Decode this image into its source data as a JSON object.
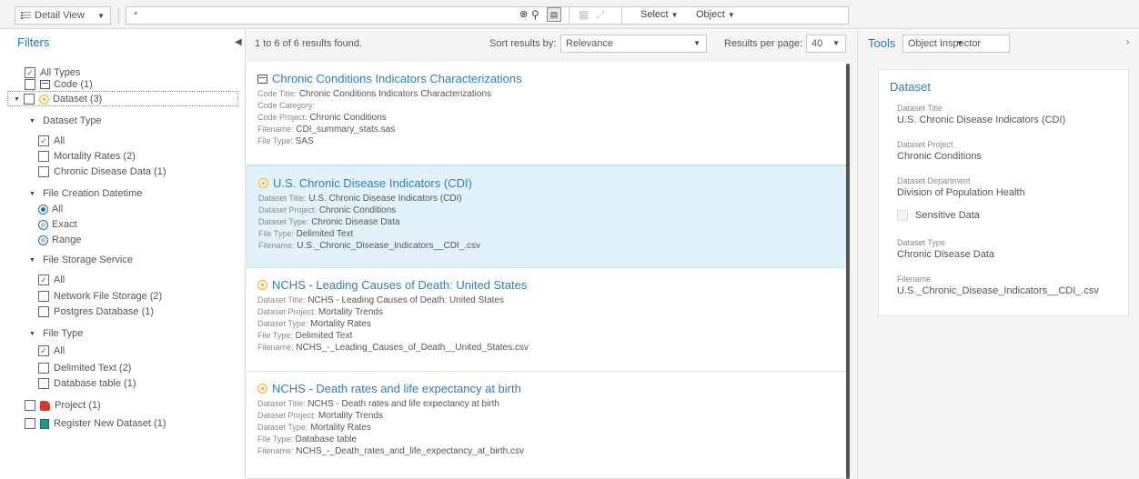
{
  "toolbar": {
    "view_label": "Detail View",
    "search_value": "*",
    "select_label": "Select",
    "object_label": "Object"
  },
  "filters": {
    "title": "Filters",
    "all_types": "All Types",
    "code": "Code (1)",
    "dataset": "Dataset (3)",
    "dataset_type": {
      "title": "Dataset Type",
      "options": [
        "All",
        "Mortality Rates (2)",
        "Chronic Disease Data (1)"
      ]
    },
    "file_creation": {
      "title": "File Creation Datetime",
      "options": [
        "All",
        "Exact",
        "Range"
      ]
    },
    "file_storage": {
      "title": "File Storage Service",
      "options": [
        "All",
        "Network File Storage (2)",
        "Postgres Database (1)"
      ]
    },
    "file_type": {
      "title": "File Type",
      "options": [
        "All",
        "Delimited Text (2)",
        "Database table (1)"
      ]
    },
    "project": "Project (1)",
    "register": "Register New Dataset (1)"
  },
  "results": {
    "count": "1 to 6 of 6 results found.",
    "sort_label": "Sort results by:",
    "sort_value": "Relevance",
    "per_page_label": "Results per page:",
    "per_page_value": "40",
    "cards": [
      {
        "title": "Chronic Conditions Indicators Characterizations",
        "lines": [
          {
            "k": "Code Title:",
            "v": "Chronic Conditions Indicators Characterizations"
          },
          {
            "k": "Code Category:",
            "v": ""
          },
          {
            "k": "Code Project:",
            "v": "Chronic Conditions"
          },
          {
            "k": "Filename:",
            "v": "CDI_summary_stats.sas"
          },
          {
            "k": "File Type:",
            "v": "SAS"
          }
        ]
      },
      {
        "title": "U.S. Chronic Disease Indicators (CDI)",
        "lines": [
          {
            "k": "Dataset Title:",
            "v": "U.S. Chronic Disease Indicators (CDI)"
          },
          {
            "k": "Dataset Project:",
            "v": "Chronic Conditions"
          },
          {
            "k": "Dataset Type:",
            "v": "Chronic Disease Data"
          },
          {
            "k": "File Type:",
            "v": "Delimited Text"
          },
          {
            "k": "Filename:",
            "v": "U.S._Chronic_Disease_Indicators__CDI_.csv"
          }
        ]
      },
      {
        "title": "NCHS - Leading Causes of Death: United States",
        "lines": [
          {
            "k": "Dataset Title:",
            "v": "NCHS - Leading Causes of Death: United States"
          },
          {
            "k": "Dataset Project:",
            "v": "Mortality Trends"
          },
          {
            "k": "Dataset Type:",
            "v": "Mortality Rates"
          },
          {
            "k": "File Type:",
            "v": "Delimited Text"
          },
          {
            "k": "Filename:",
            "v": "NCHS_-_Leading_Causes_of_Death__United_States.csv"
          }
        ]
      },
      {
        "title": "NCHS - Death rates and life expectancy at birth",
        "lines": [
          {
            "k": "Dataset Title:",
            "v": "NCHS - Death rates and life expectancy at birth"
          },
          {
            "k": "Dataset Project:",
            "v": "Mortality Trends"
          },
          {
            "k": "Dataset Type:",
            "v": "Mortality Rates"
          },
          {
            "k": "File Type:",
            "v": "Database table"
          },
          {
            "k": "Filename:",
            "v": "NCHS_-_Death_rates_and_life_expectancy_at_birth.csv"
          }
        ]
      }
    ]
  },
  "tools": {
    "title": "Tools",
    "inspector_label": "Object Inspector",
    "inspector": {
      "title": "Dataset",
      "dataset_title_label": "Dataset Title",
      "dataset_title": "U.S. Chronic Disease Indicators (CDI)",
      "dataset_project_label": "Dataset Project",
      "dataset_project": "Chronic Conditions",
      "dataset_department_label": "Dataset Department",
      "dataset_department": "Division of Population Health",
      "sensitive_label": "Sensitive Data",
      "dataset_type_label": "Dataset Type",
      "dataset_type": "Chronic Disease Data",
      "filename_label": "Filename",
      "filename": "U.S._Chronic_Disease_Indicators__CDI_.csv"
    }
  }
}
